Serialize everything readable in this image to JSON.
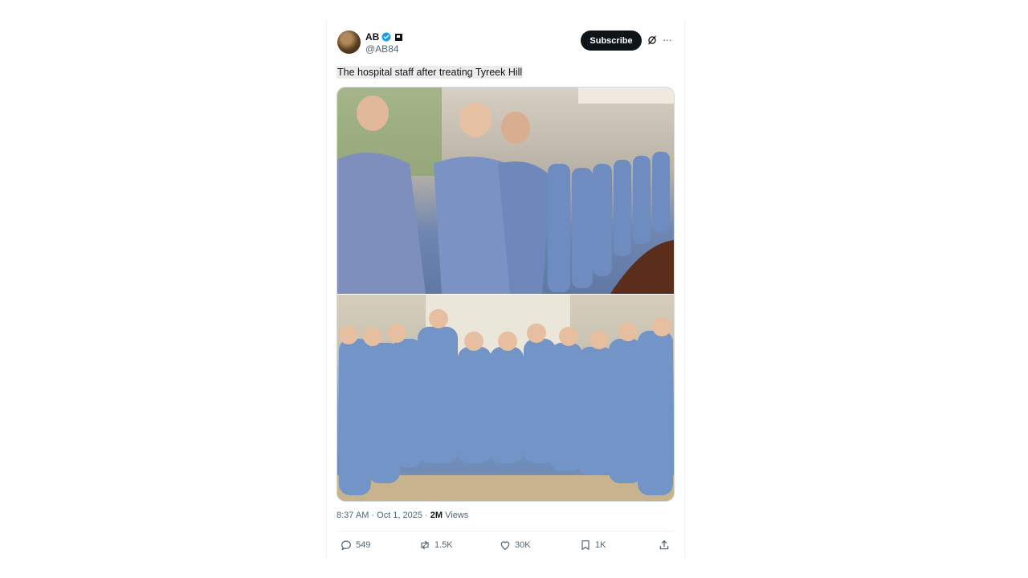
{
  "author": {
    "name": "AB",
    "handle": "@AB84",
    "verified_color": "#1d9bf0"
  },
  "header": {
    "subscribe_label": "Subscribe",
    "grok_icon": "grok-icon",
    "more_label": "···"
  },
  "tweet": {
    "text": "The hospital staff after treating Tyreek Hill",
    "media": [
      {
        "alt": "Group of nurses in blue scrubs posing in a hallway"
      },
      {
        "alt": "Group of nurses in blue scrubs posing in a lobby"
      }
    ],
    "time": "8:37 AM · Oct 1, 2025 · ",
    "views_count": "2M",
    "views_label": " Views"
  },
  "actions": {
    "replies": "549",
    "reposts": "1.5K",
    "likes": "30K",
    "bookmarks": "1K"
  },
  "colors": {
    "text": "#0f1419",
    "muted": "#536471",
    "accent": "#1d9bf0"
  }
}
